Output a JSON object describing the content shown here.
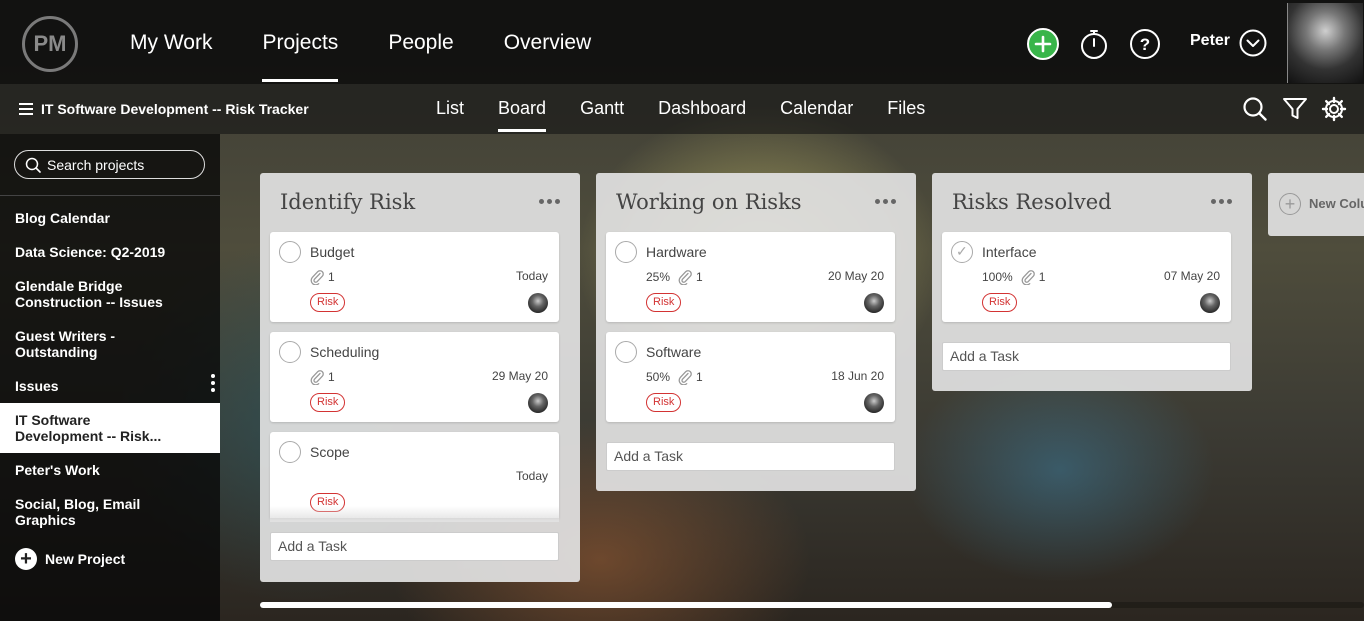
{
  "app": {
    "logo_text": "PM"
  },
  "top_nav": {
    "items": [
      {
        "label": "My Work",
        "active": false
      },
      {
        "label": "Projects",
        "active": true
      },
      {
        "label": "People",
        "active": false
      },
      {
        "label": "Overview",
        "active": false
      }
    ],
    "user_name": "Peter",
    "icons": [
      "add-icon",
      "timer-icon",
      "help-icon",
      "chevron-down-icon"
    ],
    "add_color": "#39b54a"
  },
  "sub_bar": {
    "project_title": "IT Software Development -- Risk Tracker",
    "tabs": [
      {
        "label": "List",
        "active": false
      },
      {
        "label": "Board",
        "active": true
      },
      {
        "label": "Gantt",
        "active": false
      },
      {
        "label": "Dashboard",
        "active": false
      },
      {
        "label": "Calendar",
        "active": false
      },
      {
        "label": "Files",
        "active": false
      }
    ]
  },
  "sidebar": {
    "search_placeholder": "Search projects",
    "projects": [
      {
        "lines": [
          "Blog Calendar"
        ],
        "active": false
      },
      {
        "lines": [
          "Data Science: Q2-2019"
        ],
        "active": false
      },
      {
        "lines": [
          "Glendale Bridge",
          "Construction -- Issues"
        ],
        "active": false
      },
      {
        "lines": [
          "Guest Writers -",
          "Outstanding"
        ],
        "active": false
      },
      {
        "lines": [
          "Issues"
        ],
        "active": false
      },
      {
        "lines": [
          "IT Software",
          "Development -- Risk..."
        ],
        "active": true
      },
      {
        "lines": [
          "Peter's Work"
        ],
        "active": false
      },
      {
        "lines": [
          "Social, Blog, Email",
          "Graphics"
        ],
        "active": false
      }
    ],
    "new_project_label": "New Project"
  },
  "board": {
    "columns": [
      {
        "title": "Identify Risk",
        "cards": [
          {
            "name": "Budget",
            "percent": "",
            "attachments": "1",
            "date": "Today",
            "tag": "Risk",
            "done": false
          },
          {
            "name": "Scheduling",
            "percent": "",
            "attachments": "1",
            "date": "29 May 20",
            "tag": "Risk",
            "done": false
          },
          {
            "name": "Scope",
            "percent": "",
            "attachments": "",
            "date": "Today",
            "tag": "Risk",
            "done": false
          }
        ],
        "add_task_placeholder": "Add a Task"
      },
      {
        "title": "Working on Risks",
        "cards": [
          {
            "name": "Hardware",
            "percent": "25%",
            "attachments": "1",
            "date": "20 May 20",
            "tag": "Risk",
            "done": false
          },
          {
            "name": "Software",
            "percent": "50%",
            "attachments": "1",
            "date": "18 Jun 20",
            "tag": "Risk",
            "done": false
          }
        ],
        "add_task_placeholder": "Add a Task"
      },
      {
        "title": "Risks Resolved",
        "cards": [
          {
            "name": "Interface",
            "percent": "100%",
            "attachments": "1",
            "date": "07 May 20",
            "tag": "Risk",
            "done": true
          }
        ],
        "add_task_placeholder": "Add a Task"
      }
    ],
    "new_column_label": "New Column",
    "tag_color": "#d33333",
    "scroll_position": 0.77
  }
}
